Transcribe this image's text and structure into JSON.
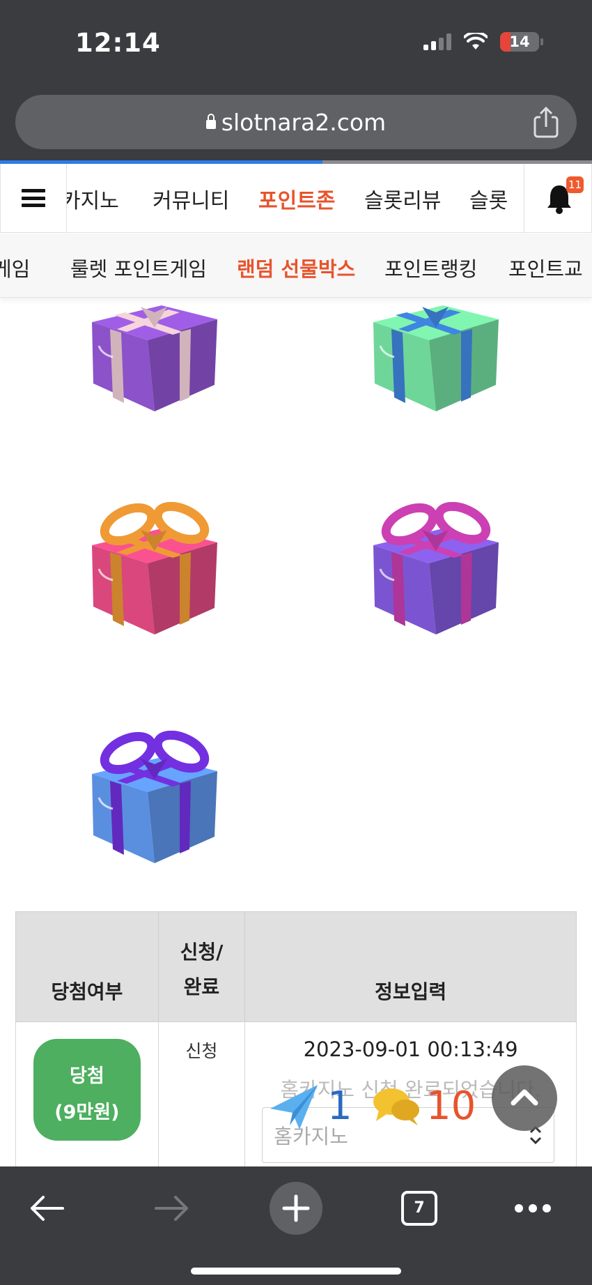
{
  "status_bar": {
    "time": "12:14",
    "battery": "14"
  },
  "browser": {
    "url": "slotnara2.com",
    "tab_count": "7",
    "load_progress": 0.545
  },
  "main_nav": {
    "items": [
      "카지노",
      "커뮤니티",
      "포인트존",
      "슬롯리뷰",
      "슬롯"
    ],
    "active": "포인트존",
    "notification_count": "11"
  },
  "sub_nav": {
    "items": [
      "게임",
      "룰렛 포인트게임",
      "랜덤 선물박스",
      "포인트랭킹",
      "포인트교"
    ],
    "active": "랜덤 선물박스"
  },
  "gift_boxes": [
    {
      "box": "#8b52c9",
      "ribbon": "#f6d4dc"
    },
    {
      "box": "#6fd69a",
      "ribbon": "#3f86e0"
    },
    {
      "box": "#d9477d",
      "ribbon": "#ef9a35"
    },
    {
      "box": "#7b55d1",
      "ribbon": "#cc40b3"
    },
    {
      "box": "#5a8fe0",
      "ribbon": "#7330e0"
    }
  ],
  "table": {
    "headers": {
      "result": "당첨여부",
      "status": "신청/\n완료",
      "info": "정보입력"
    },
    "rows": [
      {
        "result_line1": "당첨",
        "result_line2": "(9만원)",
        "status": "신청",
        "datetime": "2023-09-01 00:13:49",
        "message": "홈카지노 신청 완료되었습니다.",
        "select_value": "홈카지노"
      }
    ]
  },
  "floating": {
    "messages": "1",
    "chats": "10"
  },
  "colors": {
    "accent": "#e8532c",
    "win": "#4daf5f",
    "chrome": "#3a3c3f"
  }
}
